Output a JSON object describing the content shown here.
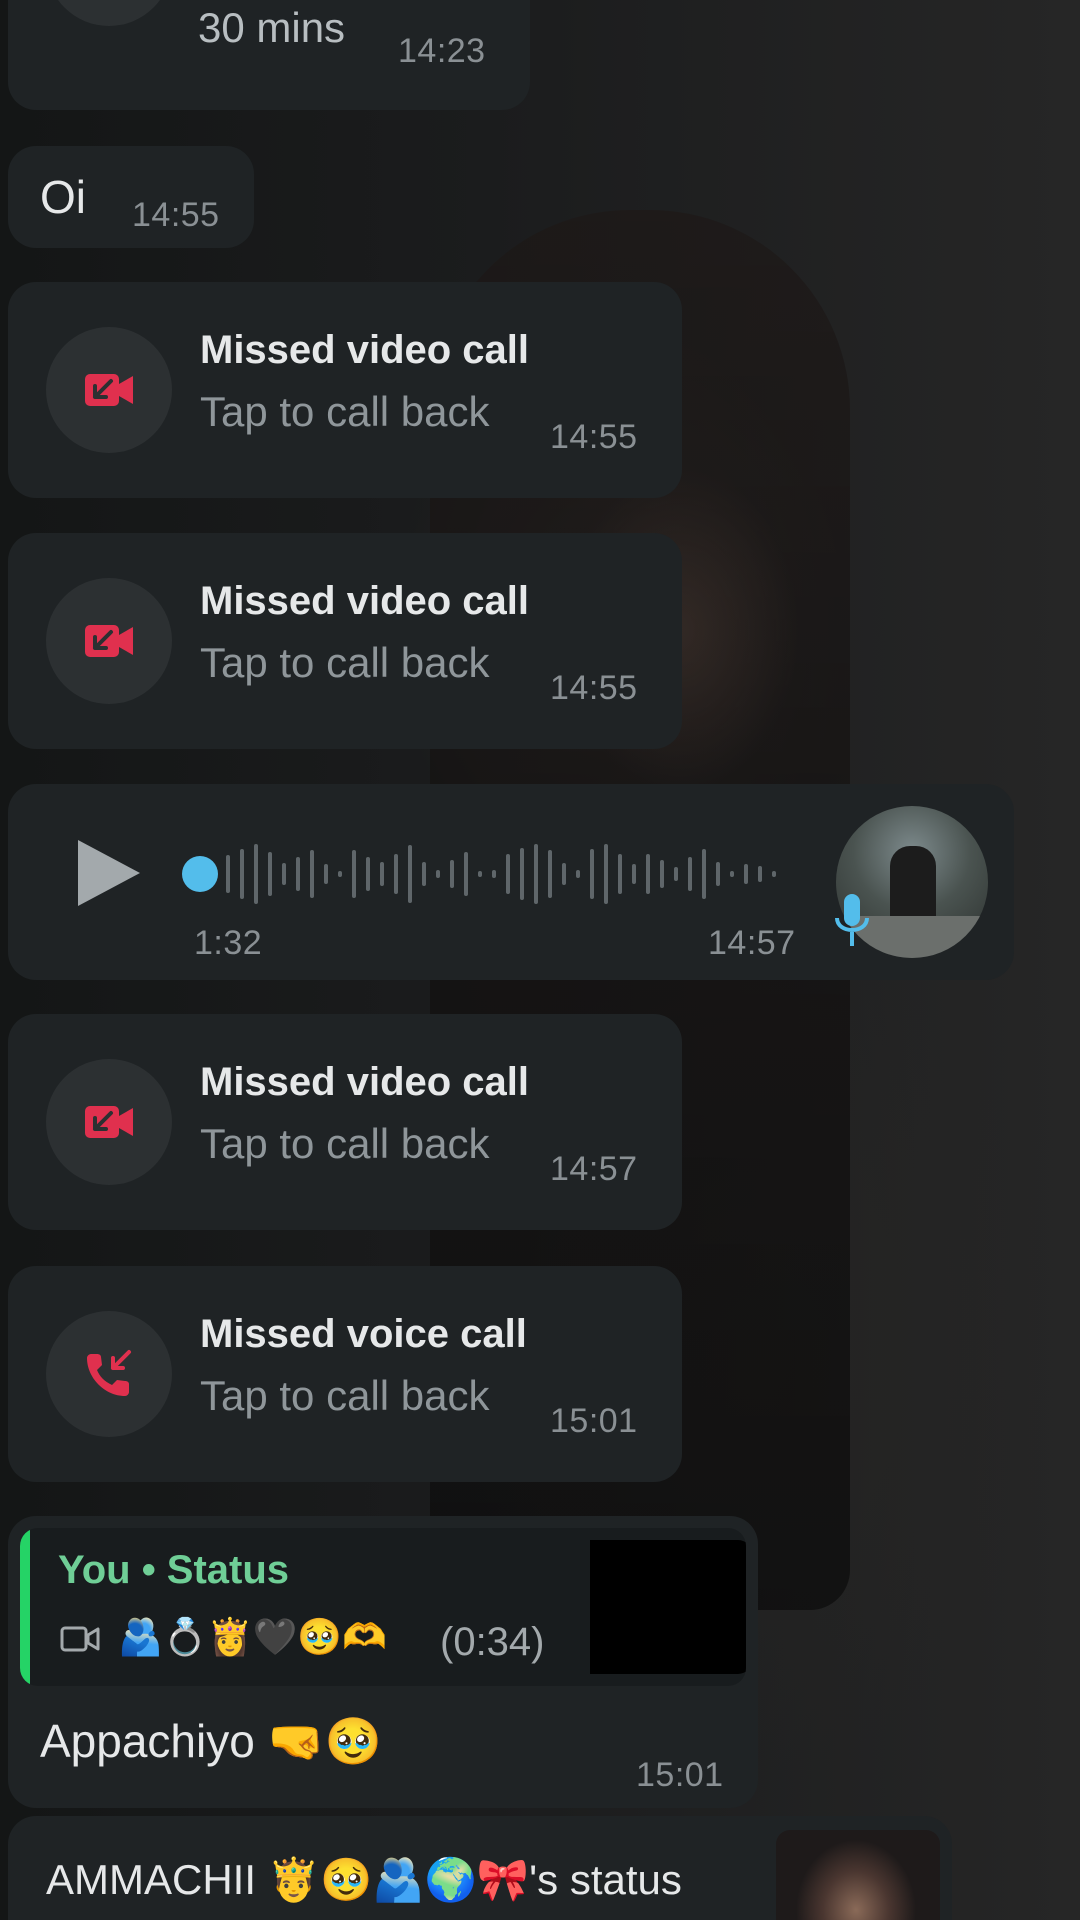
{
  "messages": {
    "top_call": {
      "subtitle": "30 mins",
      "time": "14:23"
    },
    "text_oi": {
      "text": "Oi",
      "time": "14:55"
    },
    "call_1": {
      "title": "Missed video call",
      "subtitle": "Tap to call back",
      "time": "14:55",
      "icon": "missed-video-call-icon"
    },
    "call_2": {
      "title": "Missed video call",
      "subtitle": "Tap to call back",
      "time": "14:55",
      "icon": "missed-video-call-icon"
    },
    "voice_note": {
      "duration": "1:32",
      "time": "14:57",
      "progress": 0
    },
    "call_3": {
      "title": "Missed video call",
      "subtitle": "Tap to call back",
      "time": "14:57",
      "icon": "missed-video-call-icon"
    },
    "call_4": {
      "title": "Missed voice call",
      "subtitle": "Tap to call back",
      "time": "15:01",
      "icon": "missed-voice-call-icon"
    },
    "status_reply": {
      "quote_author": "You • Status",
      "quote_emojis": "🫂💍👸🖤🥹🫶",
      "quote_duration": "(0:34)",
      "text": "Appachiyo 🤜🥹",
      "time": "15:01"
    },
    "status_mention": {
      "text": "AMMACHII 🤴🥹🫂🌍🎀's status"
    }
  },
  "colors": {
    "bubble": "#1f2325",
    "missed_call_red": "#e0304e",
    "status_green": "#25d366",
    "quote_author_green": "#6fce96",
    "voice_blue": "#53bdeb"
  }
}
